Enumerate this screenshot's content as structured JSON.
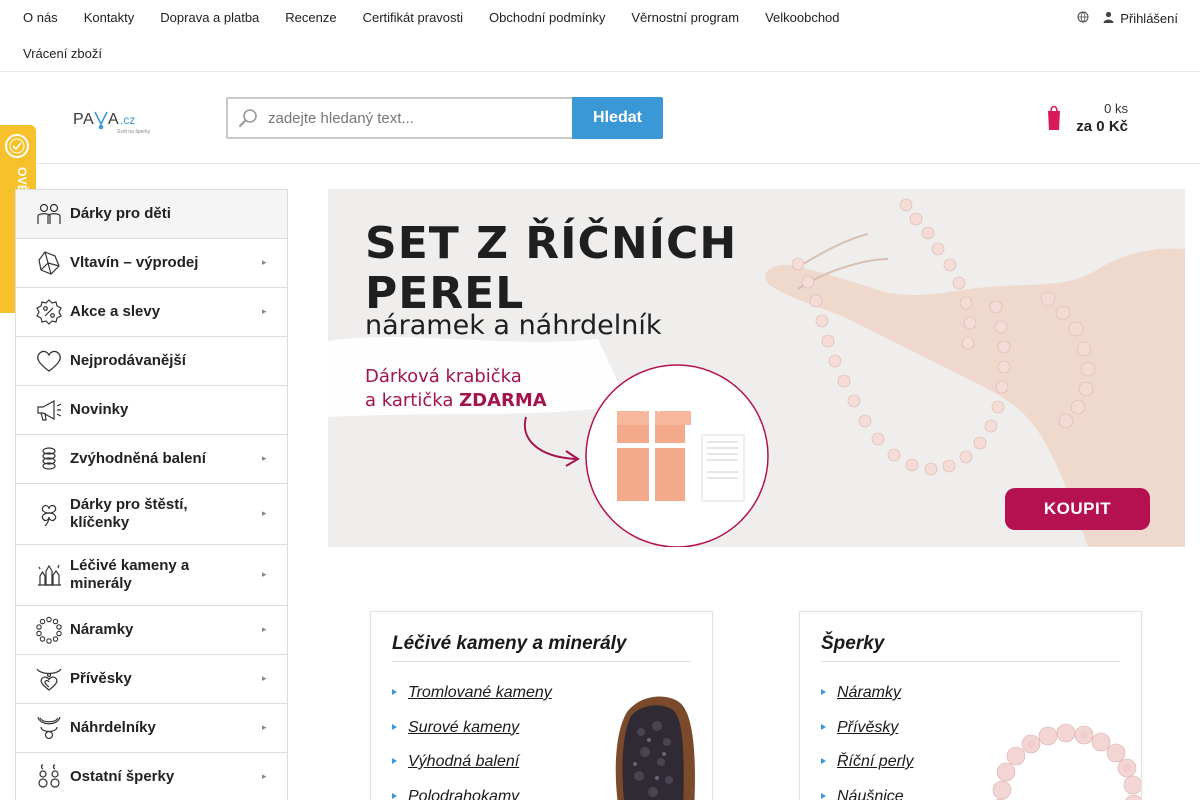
{
  "topnav": {
    "links": [
      "O nás",
      "Kontakty",
      "Doprava a platba",
      "Recenze",
      "Certifikát pravosti",
      "Obchodní podmínky",
      "Věrnostní program",
      "Velkoobchod",
      "Vrácení zboží"
    ],
    "login_label": "Přihlášení",
    "icons": [
      "globe-icon",
      "user-icon"
    ]
  },
  "header": {
    "logo_text": "PAVA.cz",
    "logo_tagline": "Svět na šperky",
    "search_placeholder": "zadejte hledaný text...",
    "search_button": "Hledat",
    "cart_qty": "0 ks",
    "cart_total": "za 0 Kč"
  },
  "verified_badge": {
    "text": "OVĚŘENO ZÁKAZNÍKY"
  },
  "sidebar": {
    "categories": [
      {
        "label": "Dárky pro děti",
        "icon": "children-icon",
        "has_submenu": false
      },
      {
        "label": "Vltavín – výprodej",
        "icon": "moldavite-icon",
        "has_submenu": true
      },
      {
        "label": "Akce a slevy",
        "icon": "percent-badge-icon",
        "has_submenu": true
      },
      {
        "label": "Nejprodávanější",
        "icon": "heart-icon",
        "has_submenu": false
      },
      {
        "label": "Novinky",
        "icon": "megaphone-icon",
        "has_submenu": false
      },
      {
        "label": "Zvýhodněná balení",
        "icon": "stacked-rings-icon",
        "has_submenu": true
      },
      {
        "label": "Dárky pro štěstí, klíčenky",
        "icon": "clover-icon",
        "has_submenu": true
      },
      {
        "label": "Léčivé kameny a minerály",
        "icon": "crystals-icon",
        "has_submenu": true
      },
      {
        "label": "Náramky",
        "icon": "bracelet-icon",
        "has_submenu": true
      },
      {
        "label": "Přívěsky",
        "icon": "heart-pendant-icon",
        "has_submenu": true
      },
      {
        "label": "Náhrdelníky",
        "icon": "necklace-icon",
        "has_submenu": true
      },
      {
        "label": "Ostatní šperky",
        "icon": "earrings-icon",
        "has_submenu": true
      }
    ]
  },
  "banner": {
    "title_line1": "SET Z ŘÍČNÍCH",
    "title_line2": "PEREL",
    "subtitle": "náramek a náhrdelník",
    "promo_line1": "Dárková krabička",
    "promo_line2_prefix": "a kartička ",
    "promo_line2_bold": "ZDARMA",
    "button": "KOUPIT"
  },
  "boxes": [
    {
      "title": "Léčivé kameny a minerály",
      "links": [
        "Tromlované kameny",
        "Surové kameny",
        "Výhodná balení",
        "Polodrahokamy"
      ]
    },
    {
      "title": "Šperky",
      "links": [
        "Náramky",
        "Přívěsky",
        "Říční perly",
        "Náušnice"
      ]
    }
  ],
  "colors": {
    "accent_blue": "#3a98d6",
    "cart_pink": "#d8195c",
    "banner_magenta": "#b5104f",
    "badge_yellow": "#f6c12b"
  }
}
